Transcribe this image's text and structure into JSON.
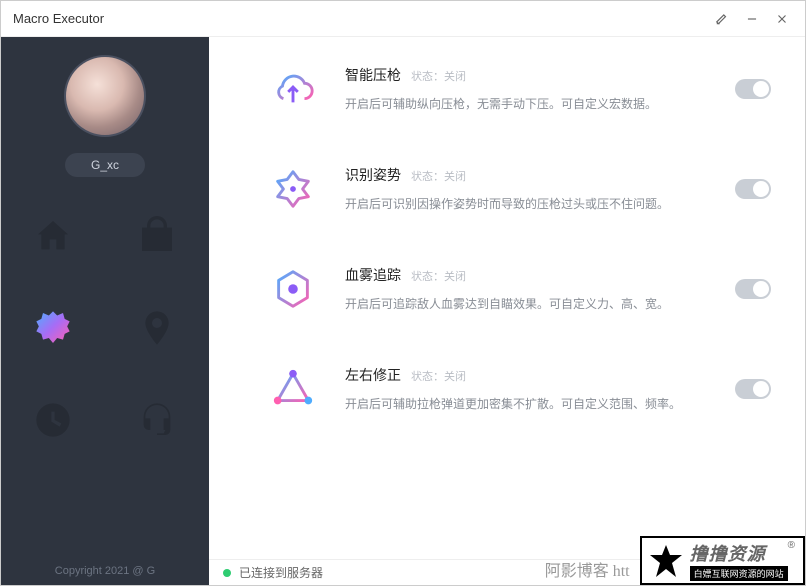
{
  "window": {
    "title": "Macro Executor"
  },
  "user": {
    "name": "G_xc"
  },
  "copyright": "Copyright 2021 @ G",
  "status": {
    "text": "已连接到服务器"
  },
  "features": [
    {
      "title": "智能压枪",
      "status": "状态：关闭",
      "desc": "开启后可辅助纵向压枪，无需手动下压。可自定义宏数据。"
    },
    {
      "title": "识别姿势",
      "status": "状态：关闭",
      "desc": "开启后可识别因操作姿势时而导致的压枪过头或压不住问题。"
    },
    {
      "title": "血雾追踪",
      "status": "状态：关闭",
      "desc": "开启后可追踪敌人血雾达到自瞄效果。可自定义力、高、宽。"
    },
    {
      "title": "左右修正",
      "status": "状态：关闭",
      "desc": "开启后可辅助拉枪弹道更加密集不扩散。可自定义范围、频率。"
    }
  ],
  "watermark": {
    "text1": "阿影博客 htt",
    "brand": "撸撸资源",
    "tag": "白嫖互联网资源的网站",
    "reg": "®"
  }
}
